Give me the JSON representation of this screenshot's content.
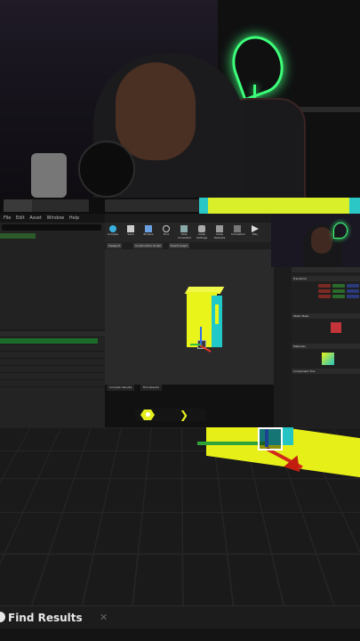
{
  "editor": {
    "tabs": [
      "",
      "",
      "",
      "",
      "",
      "",
      ""
    ],
    "menu": [
      "File",
      "Edit",
      "Asset",
      "Window",
      "Help"
    ],
    "toolbar": [
      "Compile",
      "Save",
      "Browse",
      "Find",
      "Hide Unrelated",
      "Class Settings",
      "Class Defaults",
      "Simulation",
      "Play"
    ],
    "viewport_tabs": [
      "Viewport",
      "Construction Script",
      "Event Graph"
    ],
    "bottom_tabs": [
      "Compiler Results",
      "Find Results"
    ],
    "right_panel_sections": [
      "Transform",
      "Static Mesh",
      "Materials",
      "Component Tick"
    ]
  },
  "find_results": {
    "label": "Find Results",
    "close": "✕"
  },
  "colors": {
    "accent_yellow": "#e6f018",
    "accent_cyan": "#24c4c4",
    "gizmo_red": "#d22a1a",
    "gizmo_green": "#2fa33a",
    "gizmo_blue": "#2f6df0",
    "neon_green": "#3dff7a"
  },
  "icons": [
    "compile-icon",
    "save-icon",
    "browse-icon",
    "find-icon",
    "play-icon",
    "transform-gizmo-icon",
    "find-results-icon",
    "close-icon"
  ]
}
